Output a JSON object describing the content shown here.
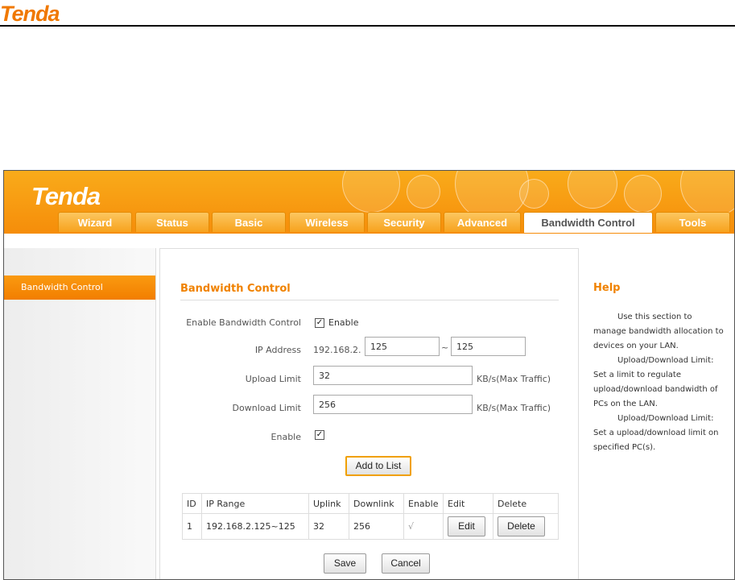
{
  "doc": {
    "logo": "Tenda"
  },
  "app": {
    "logo": "Tenda"
  },
  "tabs": [
    "Wizard",
    "Status",
    "Basic",
    "Wireless",
    "Security",
    "Advanced",
    "Bandwidth Control",
    "Tools"
  ],
  "sidebar": {
    "items": [
      {
        "label": "Bandwidth Control",
        "active": true
      }
    ]
  },
  "main": {
    "title": "Bandwidth Control",
    "enable_bw_label": "Enable Bandwidth Control",
    "enable_bw_checkbox_label": "Enable",
    "enable_bw_checked": true,
    "ip_label": "IP Address",
    "ip_prefix": "192.168.2.",
    "ip_start": "125",
    "ip_separator": "~",
    "ip_end": "125",
    "upload_label": "Upload Limit",
    "upload_value": "32",
    "upload_unit": "KB/s(Max Traffic)",
    "download_label": "Download Limit",
    "download_value": "256",
    "download_unit": "KB/s(Max Traffic)",
    "enable_label": "Enable",
    "enable_checked": true,
    "add_button": "Add to List",
    "table": {
      "headers": [
        "ID",
        "IP Range",
        "Uplink",
        "Downlink",
        "Enable",
        "Edit",
        "Delete"
      ],
      "rows": [
        {
          "id": "1",
          "ip_range": "192.168.2.125~125",
          "uplink": "32",
          "downlink": "256",
          "enable": "√",
          "edit": "Edit",
          "delete": "Delete"
        }
      ]
    },
    "save_button": "Save",
    "cancel_button": "Cancel"
  },
  "help": {
    "title": "Help",
    "paragraphs": [
      "Use this section to manage bandwidth allocation to devices on your LAN.",
      "Upload/Download Limit: Set a limit to regulate upload/download bandwidth of PCs on the LAN.",
      "Upload/Download Limit: Set a upload/download limit on specified PC(s)."
    ]
  },
  "colors": {
    "accent": "#f08200",
    "topbar": "#f9a315",
    "tab_border": "#e58b05"
  }
}
